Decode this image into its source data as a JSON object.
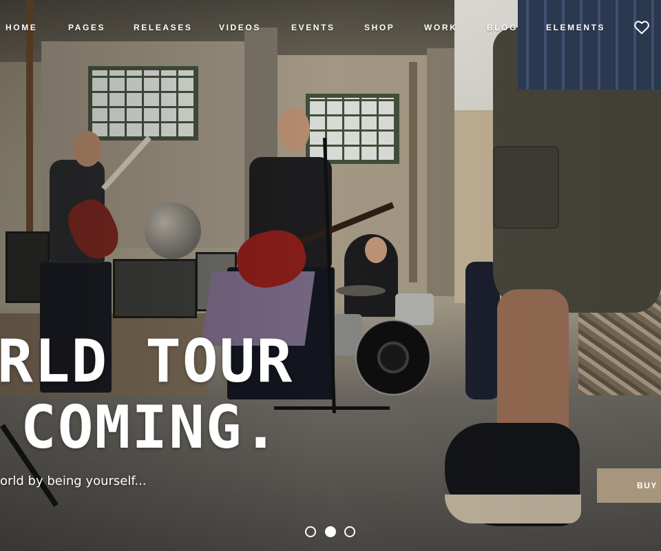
{
  "nav": {
    "items": [
      {
        "label": "HOME"
      },
      {
        "label": "PAGES"
      },
      {
        "label": "RELEASES"
      },
      {
        "label": "VIDEOS"
      },
      {
        "label": "EVENTS"
      },
      {
        "label": "SHOP"
      },
      {
        "label": "WORK"
      },
      {
        "label": "BLOG"
      },
      {
        "label": "ELEMENTS"
      }
    ],
    "wishlist_icon": "heart-icon"
  },
  "hero": {
    "headline_line1": "RLD TOUR",
    "headline_line2": "COMING.",
    "subline": "orld by being yourself...",
    "buy_label": "BUY",
    "accent_color": "#a7957d"
  },
  "slider": {
    "slide_count": 3,
    "active_slide": 2
  }
}
